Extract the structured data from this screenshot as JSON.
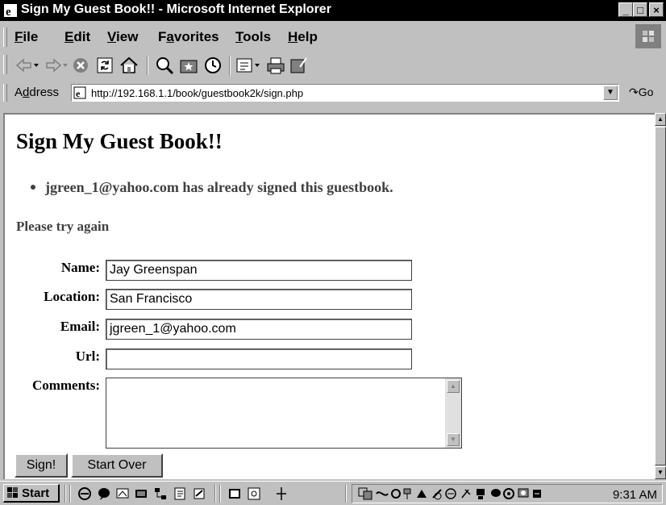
{
  "window": {
    "title": "Sign My Guest Book!! - Microsoft Internet Explorer",
    "minimize": "_",
    "maximize": "□",
    "close": "×"
  },
  "menu": {
    "items": [
      {
        "label": "File",
        "accel": "F",
        "rest": "ile"
      },
      {
        "label": "Edit",
        "accel": "E",
        "rest": "dit"
      },
      {
        "label": "View",
        "accel": "V",
        "rest": "iew"
      },
      {
        "label": "Favorites",
        "pre": "F",
        "accel": "a",
        "rest": "vorites"
      },
      {
        "label": "Tools",
        "accel": "T",
        "rest": "ools"
      },
      {
        "label": "Help",
        "accel": "H",
        "rest": "elp"
      }
    ]
  },
  "toolbar": {
    "icons": [
      "back-icon",
      "forward-icon",
      "stop-icon",
      "refresh-icon",
      "home-icon",
      "search-icon",
      "favorites-icon",
      "history-icon",
      "mail-icon",
      "print-icon",
      "edit-icon"
    ]
  },
  "address": {
    "label_accel": "d",
    "label_pre": "A",
    "label_post": "dress",
    "url": "http://192.168.1.1/book/guestbook2k/sign.php",
    "go": "Go"
  },
  "page": {
    "heading": "Sign My Guest Book!!",
    "error_item": "jgreen_1@yahoo.com has already signed this guestbook.",
    "retry_text": "Please try again"
  },
  "form": {
    "name_label": "Name:",
    "name_value": "Jay Greenspan",
    "location_label": "Location:",
    "location_value": "San Francisco",
    "email_label": "Email:",
    "email_value": "jgreen_1@yahoo.com",
    "url_label": "Url:",
    "url_value": "",
    "comments_label": "Comments:",
    "comments_value": "",
    "submit_label": "Sign!",
    "reset_label": "Start Over"
  },
  "taskbar": {
    "start_label": "Start",
    "clock": "9:31 AM"
  },
  "colors": {
    "chrome": "#c0c0c0",
    "titlebar": "#000000",
    "content_bg": "#ffffff",
    "muted_text": "#404040"
  }
}
